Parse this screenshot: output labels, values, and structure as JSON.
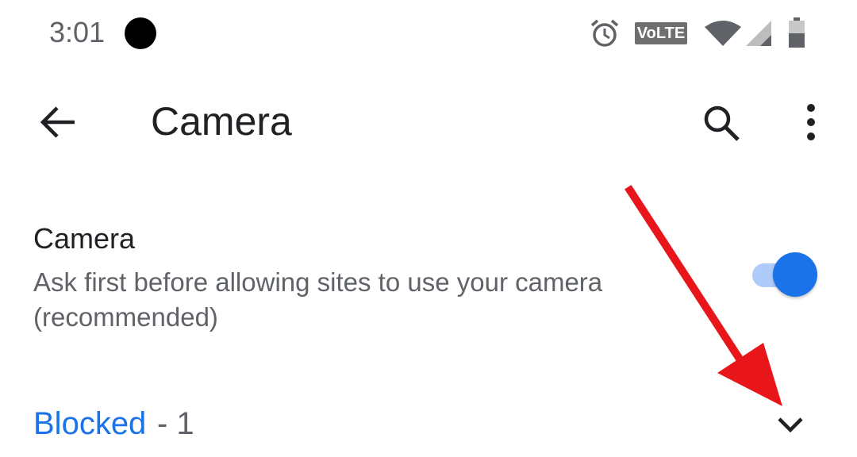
{
  "status_bar": {
    "time": "3:01",
    "volte": "VoLTE",
    "icons": [
      "notification-dot-icon",
      "alarm-icon",
      "volte-icon",
      "wifi-icon",
      "cell-signal-icon",
      "battery-icon"
    ]
  },
  "app_bar": {
    "title": "Camera",
    "icons": [
      "back-arrow-icon",
      "search-icon",
      "more-vert-icon"
    ]
  },
  "setting": {
    "title": "Camera",
    "summary": "Ask first before allowing sites to use your camera (recommended)",
    "enabled": true
  },
  "blocked": {
    "label": "Blocked",
    "count": " - 1",
    "icon": "chevron-down-icon"
  },
  "colors": {
    "accent": "#1a73e8",
    "accent_track": "#aecbfa",
    "primary_text": "#202124",
    "secondary_text": "#5f6368",
    "annotation_arrow": "#e8161b"
  }
}
